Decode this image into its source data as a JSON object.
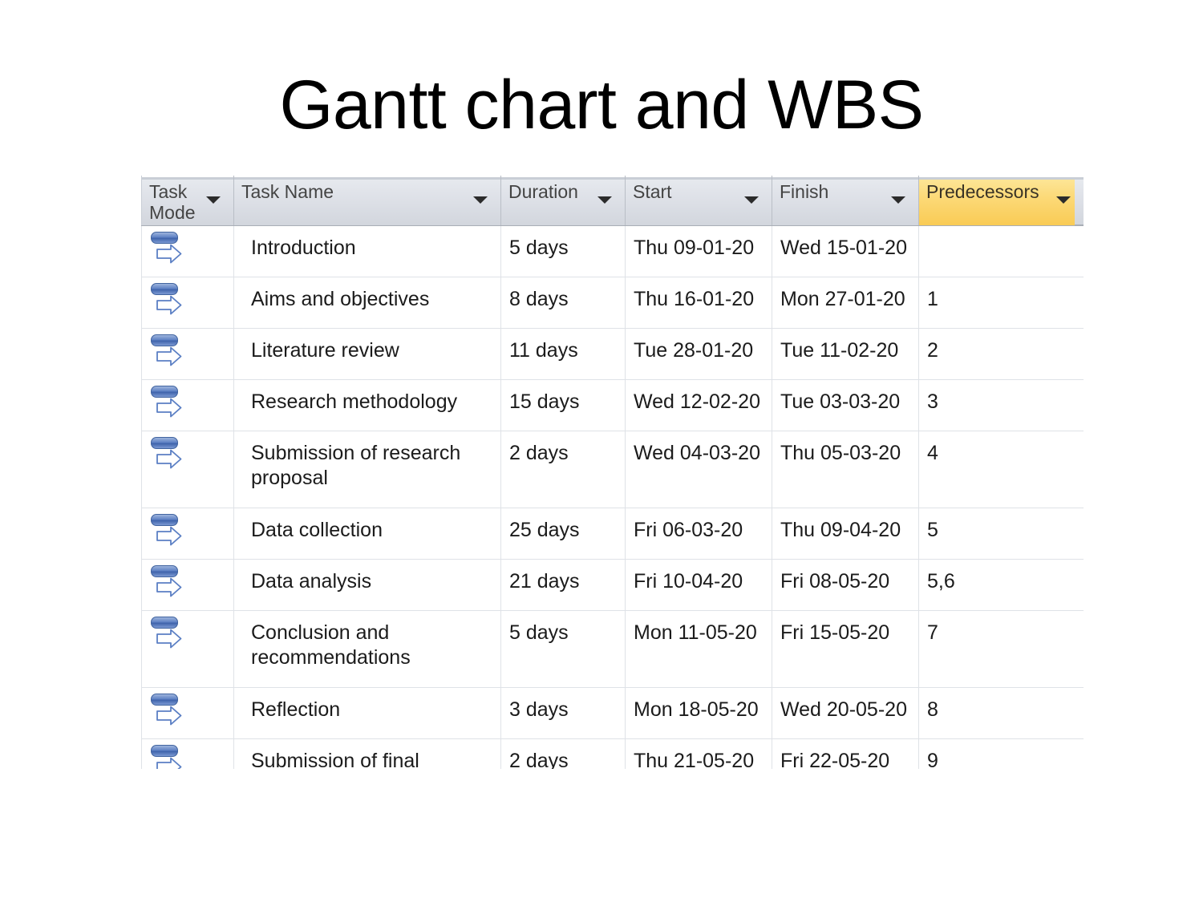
{
  "slide": {
    "title": "Gantt chart and WBS"
  },
  "table": {
    "columns": [
      {
        "key": "task_mode",
        "label": "Task Mode",
        "highlighted": false
      },
      {
        "key": "task_name",
        "label": "Task Name",
        "highlighted": false
      },
      {
        "key": "duration",
        "label": "Duration",
        "highlighted": false
      },
      {
        "key": "start",
        "label": "Start",
        "highlighted": false
      },
      {
        "key": "finish",
        "label": "Finish",
        "highlighted": false
      },
      {
        "key": "predecessors",
        "label": "Predecessors",
        "highlighted": true
      }
    ],
    "filter_icon": "filter-dropdown-arrow",
    "task_mode_icon": "auto-scheduled-icon",
    "colors": {
      "header_background": "#dcdfe6",
      "header_highlight_background": "#fcd977",
      "header_highlight_border": "#d2a32e",
      "grid_line": "#dfe2e7",
      "text": "#1b1b1b",
      "header_text": "#444444",
      "icon_blue": "#40639f"
    },
    "rows": [
      {
        "id": 1,
        "task_name": "Introduction",
        "duration": "5 days",
        "start": "Thu 09-01-20",
        "finish": "Wed 15-01-20",
        "predecessors": ""
      },
      {
        "id": 2,
        "task_name": "Aims and objectives",
        "duration": "8 days",
        "start": "Thu 16-01-20",
        "finish": "Mon 27-01-20",
        "predecessors": "1"
      },
      {
        "id": 3,
        "task_name": "Literature review",
        "duration": "11 days",
        "start": "Tue 28-01-20",
        "finish": "Tue 11-02-20",
        "predecessors": "2"
      },
      {
        "id": 4,
        "task_name": "Research methodology",
        "duration": "15 days",
        "start": "Wed 12-02-20",
        "finish": "Tue 03-03-20",
        "predecessors": "3"
      },
      {
        "id": 5,
        "task_name": "Submission of research proposal",
        "duration": "2 days",
        "start": "Wed 04-03-20",
        "finish": "Thu 05-03-20",
        "predecessors": "4"
      },
      {
        "id": 6,
        "task_name": "Data collection",
        "duration": "25 days",
        "start": "Fri 06-03-20",
        "finish": "Thu 09-04-20",
        "predecessors": "5"
      },
      {
        "id": 7,
        "task_name": "Data analysis",
        "duration": "21 days",
        "start": "Fri 10-04-20",
        "finish": "Fri 08-05-20",
        "predecessors": "5,6"
      },
      {
        "id": 8,
        "task_name": "Conclusion and recommendations",
        "duration": "5 days",
        "start": "Mon 11-05-20",
        "finish": "Fri 15-05-20",
        "predecessors": "7"
      },
      {
        "id": 9,
        "task_name": "Reflection",
        "duration": "3 days",
        "start": "Mon 18-05-20",
        "finish": "Wed 20-05-20",
        "predecessors": "8"
      },
      {
        "id": 10,
        "task_name": "Submission of final research report",
        "duration": "2 days",
        "start": "Thu 21-05-20",
        "finish": "Fri 22-05-20",
        "predecessors": "9"
      }
    ]
  }
}
